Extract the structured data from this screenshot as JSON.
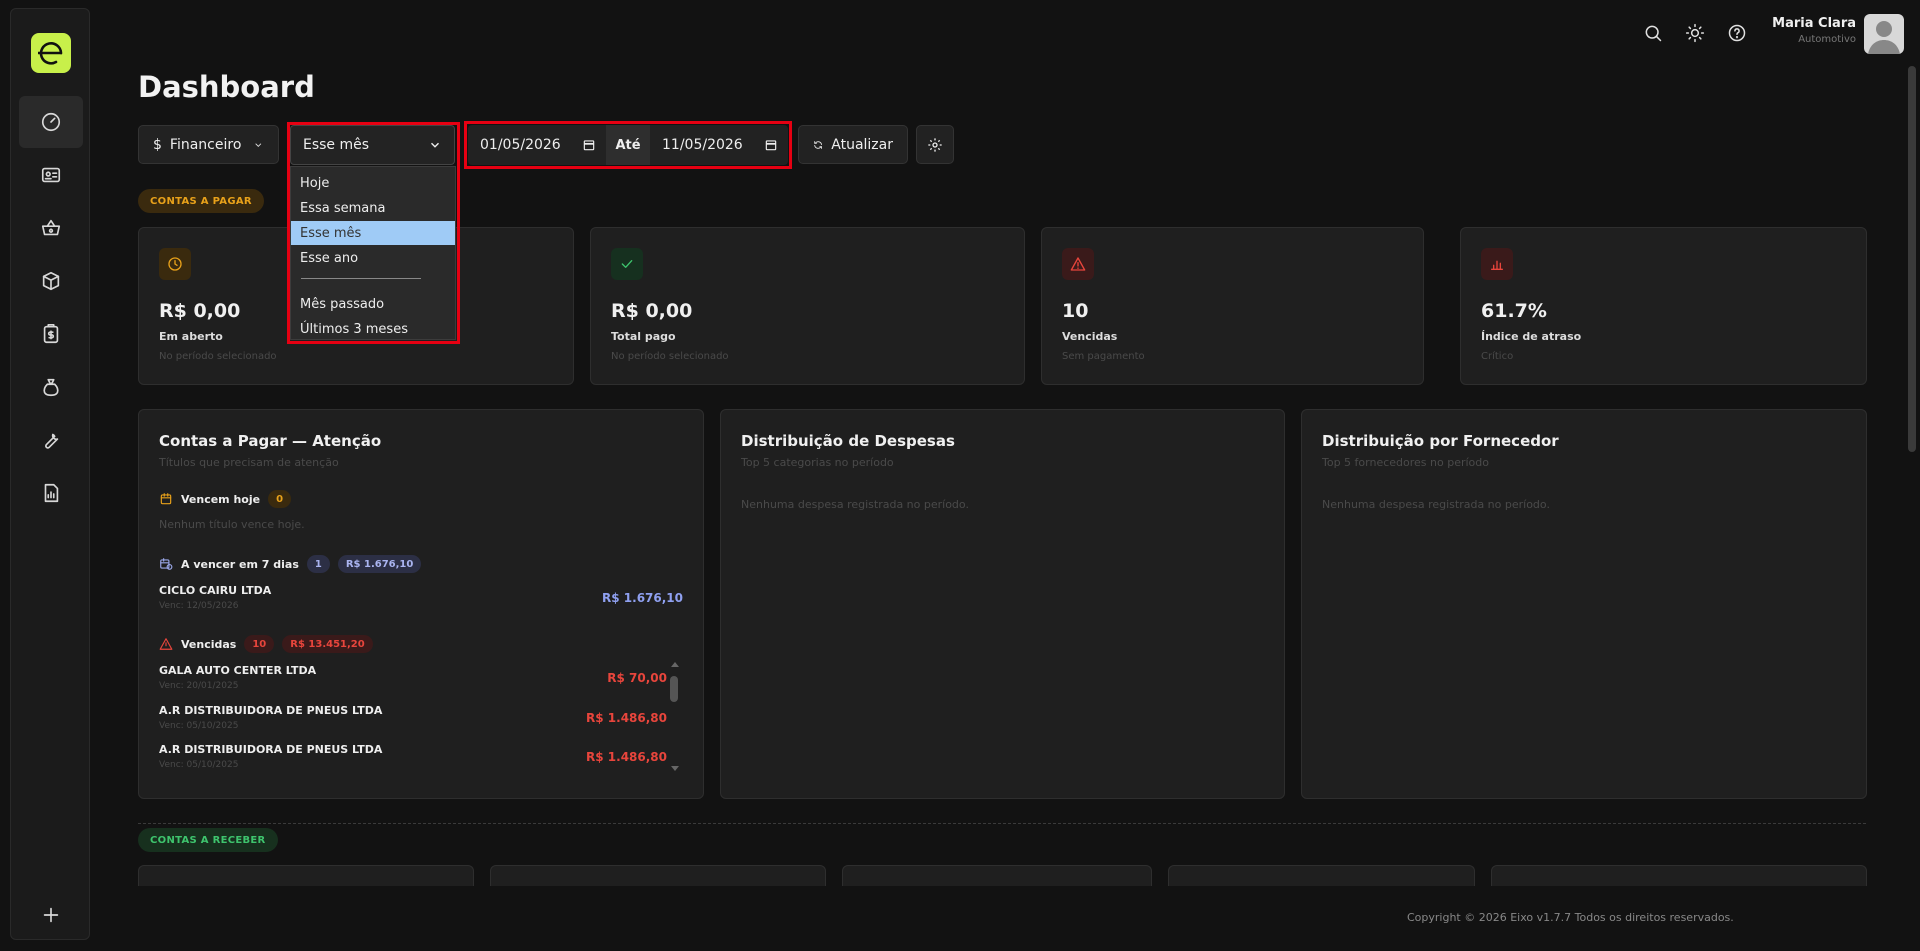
{
  "user": {
    "name": "Maria Clara",
    "role": "Automotivo"
  },
  "page": {
    "title": "Dashboard"
  },
  "toolbar": {
    "module_label": "Financeiro",
    "period_selected": "Esse mês",
    "date_from": "01/05/2026",
    "date_sep": "Até",
    "date_to": "11/05/2026",
    "refresh_label": "Atualizar"
  },
  "dropdown": {
    "options": [
      "Hoje",
      "Essa semana",
      "Esse mês",
      "Esse ano",
      "Mês passado",
      "Últimos 3 meses"
    ],
    "selected_index": 2
  },
  "sections": {
    "payable": "CONTAS A PAGAR",
    "receivable": "CONTAS A RECEBER"
  },
  "stats": [
    {
      "value": "R$ 0,00",
      "label": "Em aberto",
      "sub": "No período selecionado",
      "icon": "clock-icon",
      "color": "#e8a11a"
    },
    {
      "value": "R$ 0,00",
      "label": "Total pago",
      "sub": "No período selecionado",
      "icon": "check-icon",
      "color": "#3ec46d"
    },
    {
      "value": "10",
      "label": "Vencidas",
      "sub": "Sem pagamento",
      "icon": "warning-icon",
      "color": "#e8453c"
    },
    {
      "value": "61.7%",
      "label": "Índice de atraso",
      "sub": "Crítico",
      "icon": "bar-chart-icon",
      "color": "#e8453c"
    }
  ],
  "attention": {
    "title": "Contas a Pagar — Atenção",
    "subtitle": "Títulos que precisam de atenção",
    "today_label": "Vencem hoje",
    "today_count": "0",
    "today_empty": "Nenhum título vence hoje.",
    "week_label": "A vencer em 7 dias",
    "week_count": "1",
    "week_total": "R$ 1.676,10",
    "week_items": [
      {
        "name": "CICLO CAIRU LTDA",
        "due": "Venc: 12/05/2026",
        "amount": "R$ 1.676,10"
      }
    ],
    "overdue_label": "Vencidas",
    "overdue_count": "10",
    "overdue_total": "R$ 13.451,20",
    "overdue_items": [
      {
        "name": "GALA AUTO CENTER LTDA",
        "due": "Venc: 20/01/2025",
        "amount": "R$ 70,00"
      },
      {
        "name": "A.R DISTRIBUIDORA DE PNEUS LTDA",
        "due": "Venc: 05/10/2025",
        "amount": "R$ 1.486,80"
      },
      {
        "name": "A.R DISTRIBUIDORA DE PNEUS LTDA",
        "due": "Venc: 05/10/2025",
        "amount": "R$ 1.486,80"
      }
    ]
  },
  "expenses": {
    "title": "Distribuição de Despesas",
    "subtitle": "Top 5 categorias no período",
    "empty": "Nenhuma despesa registrada no período."
  },
  "suppliers": {
    "title": "Distribuição por Fornecedor",
    "subtitle": "Top 5 fornecedores no período",
    "empty": "Nenhuma despesa registrada no período."
  },
  "footer": {
    "text": "Copyright © 2026 Eixo v1.7.7 Todos os direitos reservados."
  },
  "colors": {
    "accent": "#c8f04a",
    "highlight": "#e60012",
    "payable": "#e8a11a",
    "receivable": "#3ec46d"
  }
}
